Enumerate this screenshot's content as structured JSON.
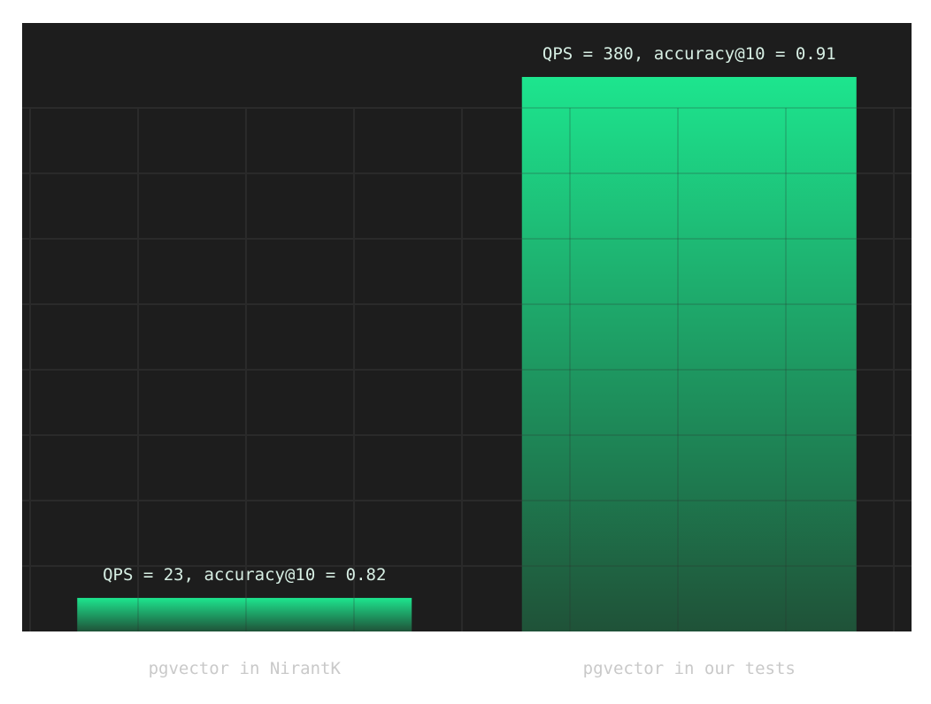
{
  "chart_data": {
    "type": "bar",
    "categories": [
      "pgvector in NirantK",
      "pgvector in our tests"
    ],
    "values": [
      23,
      380
    ],
    "data_labels": [
      "QPS = 23, accuracy@10 = 0.82",
      "QPS = 380, accuracy@10 = 0.91"
    ],
    "ylim": [
      0,
      380
    ],
    "grid": true,
    "legend": "none"
  },
  "colors": {
    "plot_background": "#1d1d1d",
    "grid": "#2a2a2a",
    "bar_top": "#1de58e",
    "bar_bottom": "#1f5238",
    "label_text": "#d7efe4",
    "category_text": "#c9c9c9"
  }
}
